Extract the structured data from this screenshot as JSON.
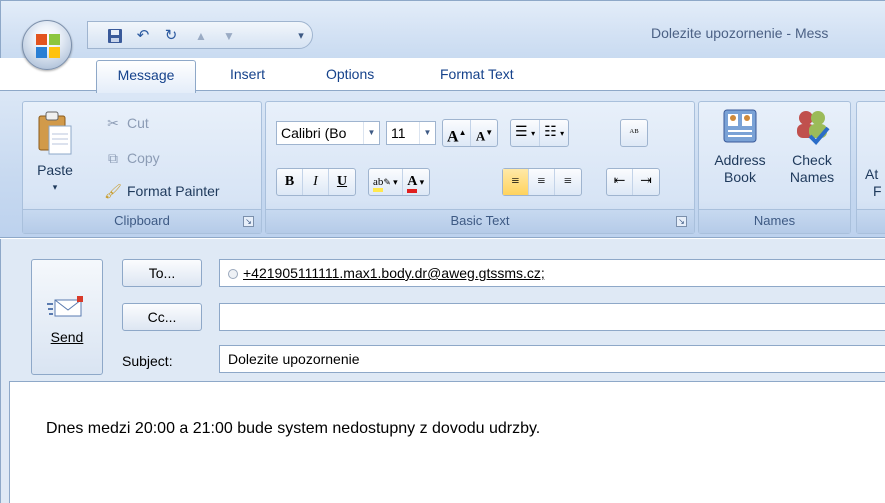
{
  "window": {
    "title": "Dolezite upozornenie - Mess"
  },
  "tabs": [
    {
      "label": "Message"
    },
    {
      "label": "Insert"
    },
    {
      "label": "Options"
    },
    {
      "label": "Format Text"
    }
  ],
  "ribbon": {
    "clipboard": {
      "label": "Clipboard",
      "paste": "Paste",
      "cut": "Cut",
      "copy": "Copy",
      "format_painter": "Format Painter"
    },
    "basic_text": {
      "label": "Basic Text",
      "font_name": "Calibri (Bo",
      "font_size": "11",
      "bold": "B",
      "italic": "I",
      "underline": "U"
    },
    "names": {
      "label": "Names",
      "address_line1": "Address",
      "address_line2": "Book",
      "check_line1": "Check",
      "check_line2": "Names"
    },
    "next_group_partial": {
      "line1": "At",
      "line2": "F"
    }
  },
  "compose": {
    "send_label": "Send",
    "to_button": "To...",
    "cc_button": "Cc...",
    "subject_label": "Subject:",
    "to_value": "+421905111111.max1.body.dr@aweg.gtssms.cz;",
    "cc_value": "",
    "subject_value": "Dolezite upozornenie",
    "body_text": "Dnes medzi 20:00 a 21:00 bude system nedostupny z dovodu udrzby."
  },
  "colors": {
    "highlight_yellow": "#ffe84d",
    "font_red": "#e02020",
    "active_button": "#ffd35e"
  }
}
